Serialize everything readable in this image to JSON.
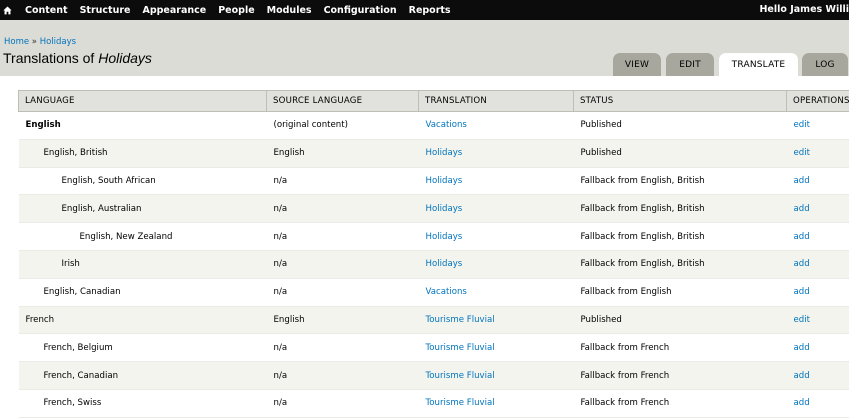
{
  "toolbar": {
    "home_icon": "home-icon",
    "menu": [
      "Content",
      "Structure",
      "Appearance",
      "People",
      "Modules",
      "Configuration",
      "Reports"
    ],
    "hello_prefix": "Hello ",
    "user": "James Willi"
  },
  "breadcrumb": {
    "home": "Home",
    "separator": " » ",
    "current": "Holidays"
  },
  "page_title": {
    "prefix": "Translations of ",
    "node": "Holidays"
  },
  "tabs": [
    {
      "label": "VIEW",
      "active": false
    },
    {
      "label": "EDIT",
      "active": false
    },
    {
      "label": "TRANSLATE",
      "active": true
    },
    {
      "label": "LOG",
      "active": false
    }
  ],
  "table": {
    "headers": [
      "LANGUAGE",
      "SOURCE LANGUAGE",
      "TRANSLATION",
      "STATUS",
      "OPERATIONS"
    ],
    "rows": [
      {
        "language": "English",
        "indent": 0,
        "bold": true,
        "source": "(original content)",
        "translation": "Vacations",
        "status": "Published",
        "operation": "edit"
      },
      {
        "language": "English, British",
        "indent": 1,
        "bold": false,
        "source": "English",
        "translation": "Holidays",
        "status": "Published",
        "operation": "edit"
      },
      {
        "language": "English, South African",
        "indent": 2,
        "bold": false,
        "source": "n/a",
        "translation": "Holidays",
        "status": "Fallback from English, British",
        "operation": "add"
      },
      {
        "language": "English, Australian",
        "indent": 2,
        "bold": false,
        "source": "n/a",
        "translation": "Holidays",
        "status": "Fallback from English, British",
        "operation": "add"
      },
      {
        "language": "English, New Zealand",
        "indent": 3,
        "bold": false,
        "source": "n/a",
        "translation": "Holidays",
        "status": "Fallback from English, British",
        "operation": "add"
      },
      {
        "language": "Irish",
        "indent": 2,
        "bold": false,
        "source": "n/a",
        "translation": "Holidays",
        "status": "Fallback from English, British",
        "operation": "add"
      },
      {
        "language": "English, Canadian",
        "indent": 1,
        "bold": false,
        "source": "n/a",
        "translation": "Vacations",
        "status": "Fallback from English",
        "operation": "add"
      },
      {
        "language": "French",
        "indent": 0,
        "bold": false,
        "source": "English",
        "translation": "Tourisme Fluvial",
        "status": "Published",
        "operation": "edit"
      },
      {
        "language": "French, Belgium",
        "indent": 1,
        "bold": false,
        "source": "n/a",
        "translation": "Tourisme Fluvial",
        "status": "Fallback from French",
        "operation": "add"
      },
      {
        "language": "French, Canadian",
        "indent": 1,
        "bold": false,
        "source": "n/a",
        "translation": "Tourisme Fluvial",
        "status": "Fallback from French",
        "operation": "add"
      },
      {
        "language": "French, Swiss",
        "indent": 1,
        "bold": false,
        "source": "n/a",
        "translation": "Tourisme Fluvial",
        "status": "Fallback from French",
        "operation": "add"
      }
    ]
  },
  "colors": {
    "toolbar_bg": "#0c0c0c",
    "header_bg": "#dcdcd6",
    "link": "#0074bd",
    "tab_bg": "#a7a79d",
    "row_even": "#f3f4ee"
  }
}
